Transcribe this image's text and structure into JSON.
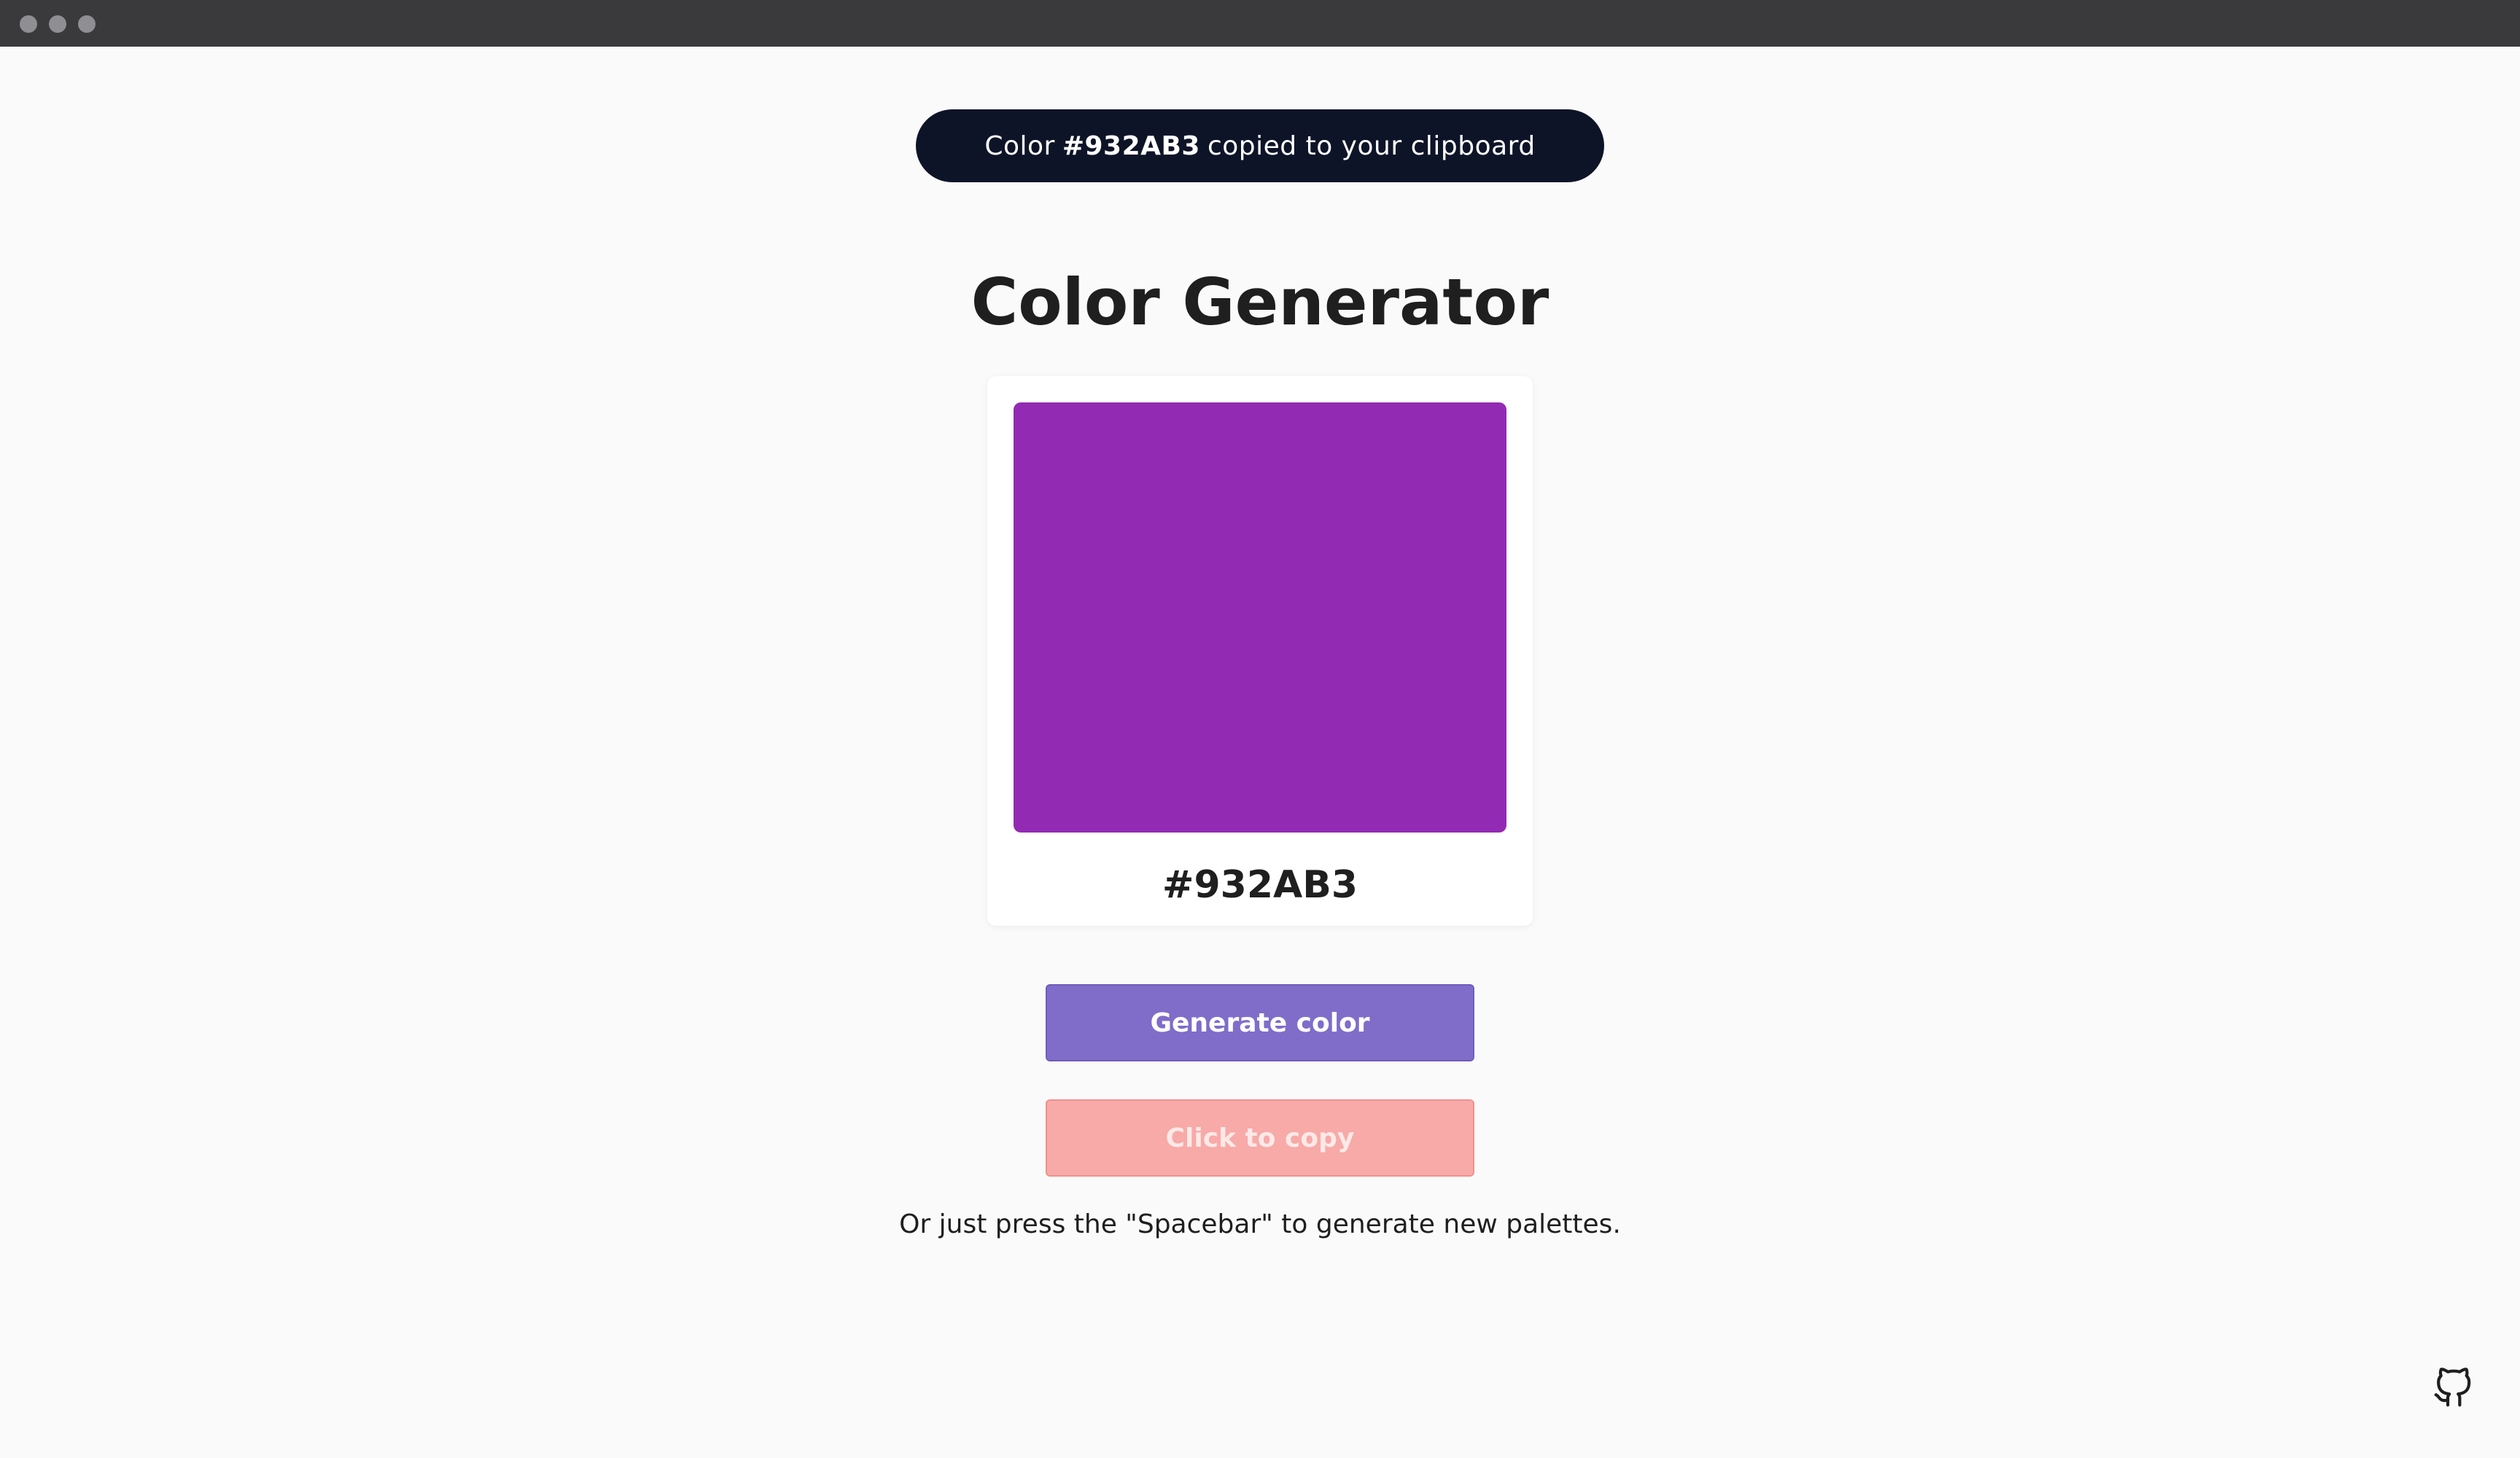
{
  "toast": {
    "prefix": "Color",
    "code": "#932AB3",
    "suffix": "copied to your clipboard"
  },
  "page_title": "Color Generator",
  "color_card": {
    "swatch_color": "#932AB3",
    "hex": "#932AB3"
  },
  "buttons": {
    "generate_label": "Generate color",
    "copy_label": "Click to copy"
  },
  "hint": "Or just press the \"Spacebar\" to generate new palettes.",
  "colors": {
    "toast_bg": "#0E1428",
    "generate_bg": "#7F6DC9",
    "copy_bg": "#F7AAA7",
    "page_bg": "#FAFAFA"
  },
  "icons": {
    "github": "github-icon"
  }
}
